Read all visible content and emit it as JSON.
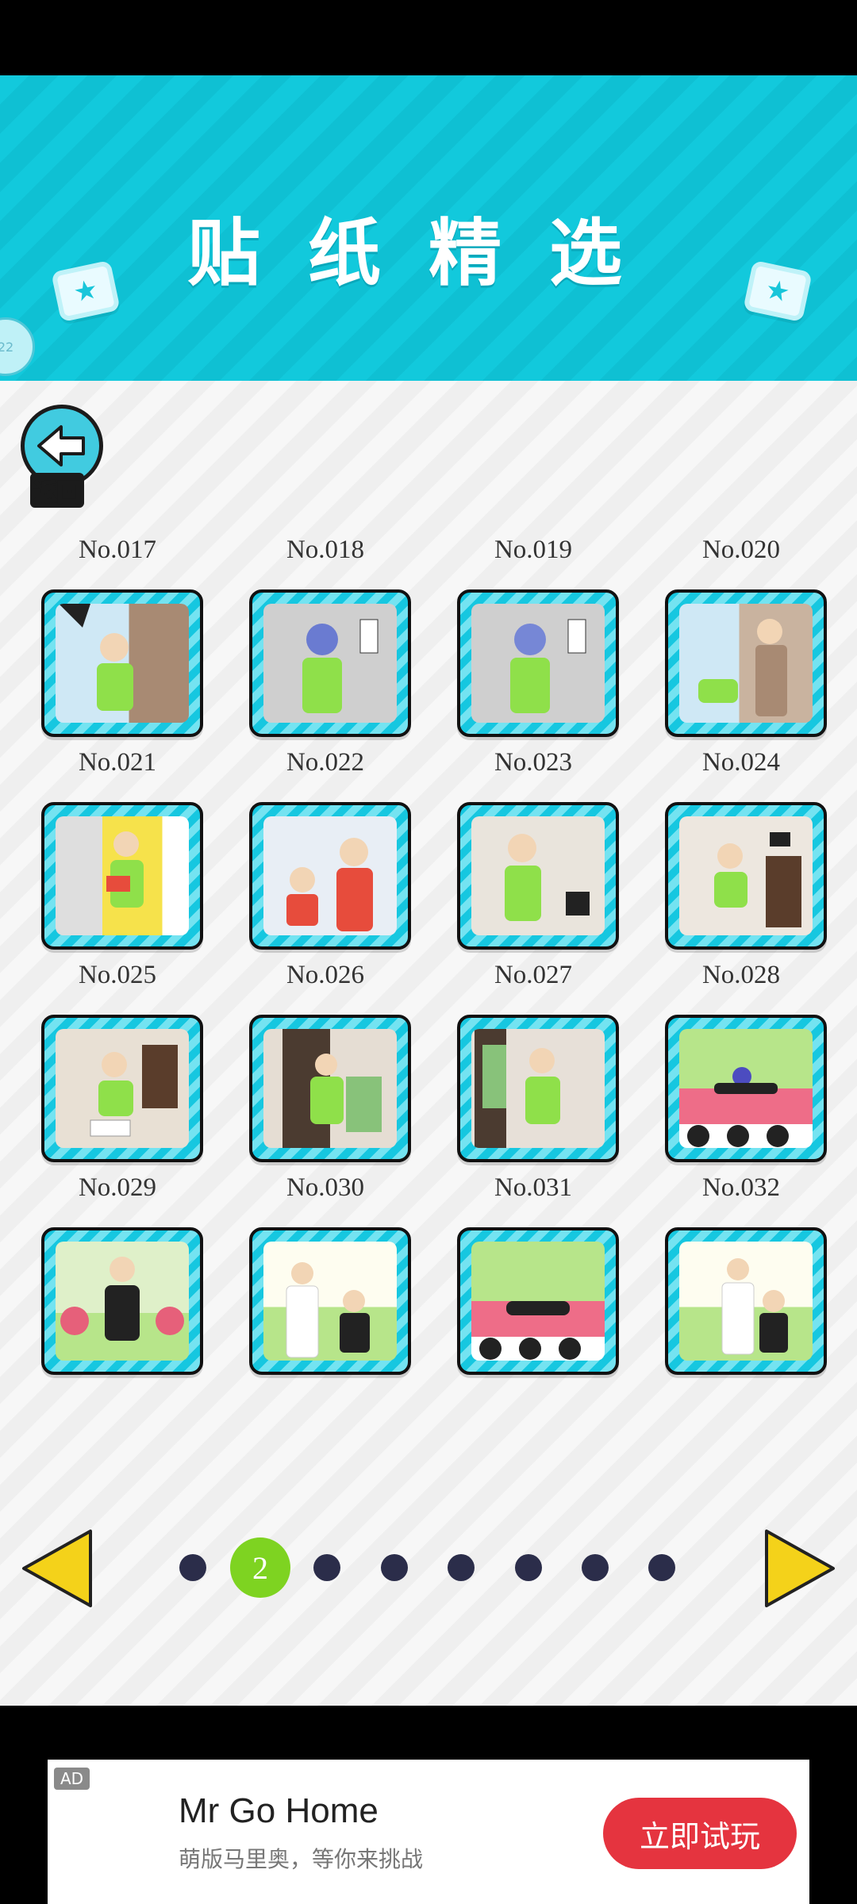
{
  "header": {
    "title": "贴纸精选",
    "left_icon": "star-icon",
    "right_icon": "star-icon",
    "side_bubble": "22"
  },
  "back_button": {
    "label": "返回",
    "icon": "arrow-left-icon"
  },
  "stickers": [
    {
      "label": "No.017"
    },
    {
      "label": "No.018"
    },
    {
      "label": "No.019"
    },
    {
      "label": "No.020"
    },
    {
      "label": "No.021"
    },
    {
      "label": "No.022"
    },
    {
      "label": "No.023"
    },
    {
      "label": "No.024"
    },
    {
      "label": "No.025"
    },
    {
      "label": "No.026"
    },
    {
      "label": "No.027"
    },
    {
      "label": "No.028"
    },
    {
      "label": "No.029"
    },
    {
      "label": "No.030"
    },
    {
      "label": "No.031"
    },
    {
      "label": "No.032"
    }
  ],
  "pager": {
    "current_page": "2",
    "prev_icon": "triangle-left-icon",
    "next_icon": "triangle-right-icon",
    "accent_color": "#7ed321"
  },
  "ad": {
    "tag": "AD",
    "title": "Mr Go Home",
    "subtitle": "萌版马里奥，等你来挑战",
    "button": "立即试玩",
    "button_color": "#e5343f"
  },
  "colors": {
    "header": "#12c9dc",
    "card_border": "#16c7e0",
    "arrow": "#f4d21a"
  }
}
